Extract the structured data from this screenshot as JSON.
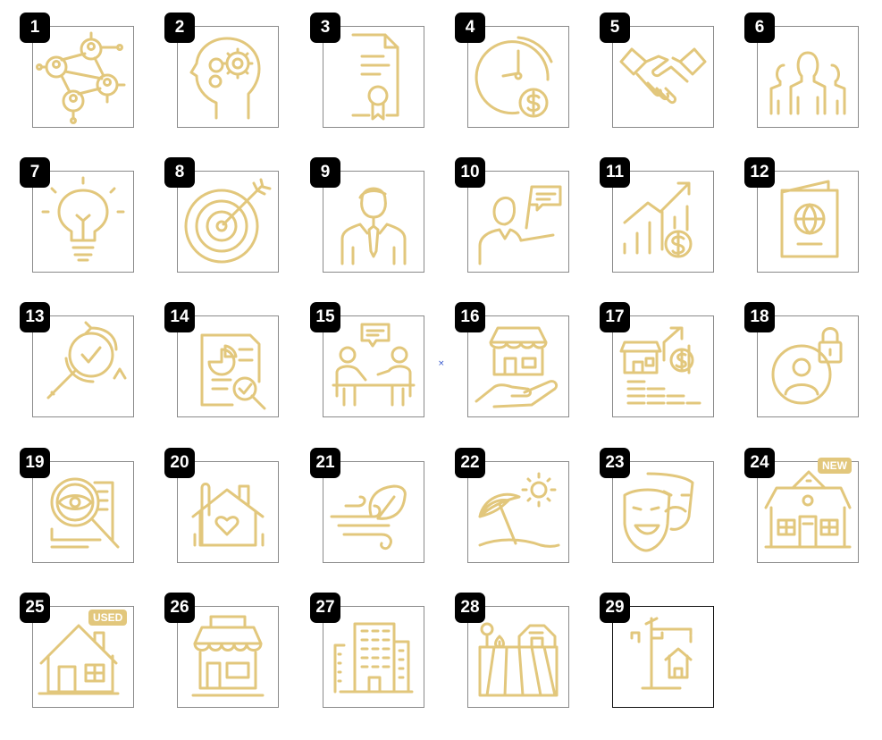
{
  "accent_color": "#e2c77c",
  "icons": [
    {
      "number": "1",
      "icon": "network-people-icon"
    },
    {
      "number": "2",
      "icon": "head-gears-icon"
    },
    {
      "number": "3",
      "icon": "certificate-icon"
    },
    {
      "number": "4",
      "icon": "clock-money-icon"
    },
    {
      "number": "5",
      "icon": "handshake-icon"
    },
    {
      "number": "6",
      "icon": "group-people-icon"
    },
    {
      "number": "7",
      "icon": "lightbulb-icon"
    },
    {
      "number": "8",
      "icon": "target-arrow-icon"
    },
    {
      "number": "9",
      "icon": "businessman-icon"
    },
    {
      "number": "10",
      "icon": "consultant-chat-icon"
    },
    {
      "number": "11",
      "icon": "growth-chart-dollar-icon"
    },
    {
      "number": "12",
      "icon": "passport-icon"
    },
    {
      "number": "13",
      "icon": "magnifier-refresh-icon"
    },
    {
      "number": "14",
      "icon": "report-analysis-icon"
    },
    {
      "number": "15",
      "icon": "meeting-presentation-icon"
    },
    {
      "number": "16",
      "icon": "hand-shop-icon"
    },
    {
      "number": "17",
      "icon": "shop-coins-growth-icon"
    },
    {
      "number": "18",
      "icon": "user-lock-icon"
    },
    {
      "number": "19",
      "icon": "document-eye-search-icon"
    },
    {
      "number": "20",
      "icon": "home-heart-icon"
    },
    {
      "number": "21",
      "icon": "wind-leaf-icon"
    },
    {
      "number": "22",
      "icon": "beach-umbrella-icon"
    },
    {
      "number": "23",
      "icon": "theater-masks-icon"
    },
    {
      "number": "24",
      "icon": "new-house-icon",
      "tag": "NEW"
    },
    {
      "number": "25",
      "icon": "used-house-icon",
      "tag": "USED"
    },
    {
      "number": "26",
      "icon": "storefront-icon"
    },
    {
      "number": "27",
      "icon": "buildings-icon"
    },
    {
      "number": "28",
      "icon": "farm-field-icon"
    },
    {
      "number": "29",
      "icon": "construction-crane-house-icon",
      "selected": true
    }
  ]
}
